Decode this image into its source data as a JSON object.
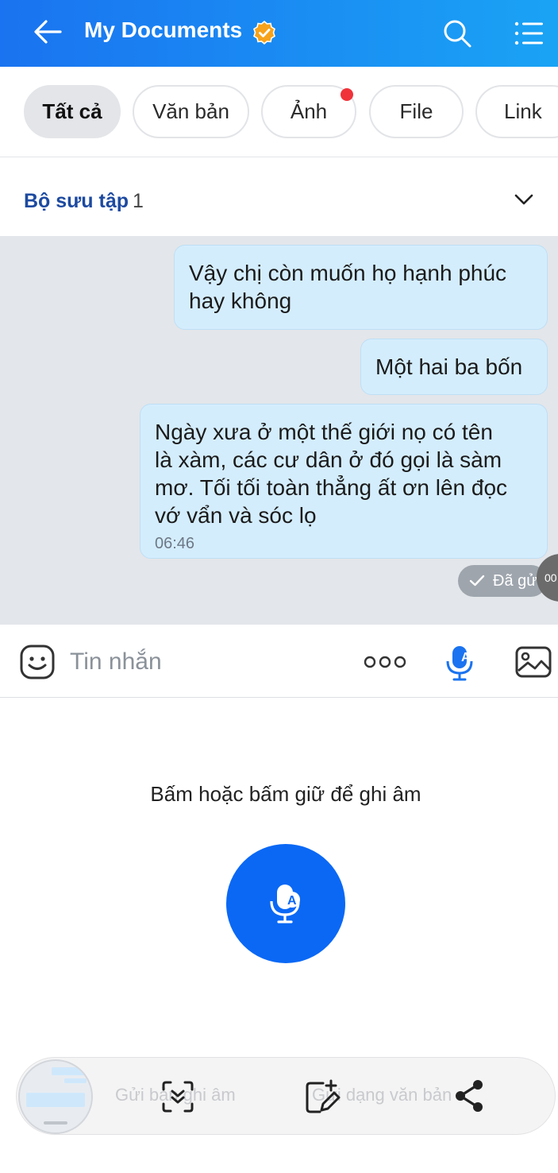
{
  "header": {
    "title": "My Documents",
    "accent_color": "#1a73f0",
    "icons": [
      "back-arrow-icon",
      "verified-badge-icon",
      "search-icon",
      "list-menu-icon"
    ]
  },
  "filters": {
    "items": [
      {
        "label": "Tất cả",
        "active": true
      },
      {
        "label": "Văn bản",
        "active": false
      },
      {
        "label": "Ảnh",
        "active": false,
        "badge": true
      },
      {
        "label": "File",
        "active": false
      },
      {
        "label": "Link",
        "active": false
      }
    ]
  },
  "collection": {
    "label": "Bộ sưu tập",
    "count": "1"
  },
  "messages": [
    {
      "lines": [
        "Vậy chị còn muốn họ hạnh phúc",
        "hay không"
      ]
    },
    {
      "lines": [
        "Một hai ba bốn"
      ]
    },
    {
      "lines": [
        "Ngày xưa ở một thế giới nọ có tên",
        "là xàm, các cư dân ở đó gọi là sàm",
        "mơ. Tối tối toàn thẳng ất ơn lên đọc",
        "vớ vẩn và sóc lọ"
      ],
      "time": "06:46"
    }
  ],
  "sent_status": "Đã gửi",
  "floating_badge": "00",
  "input": {
    "placeholder": "Tin nhắn"
  },
  "record": {
    "hint": "Bấm hoặc bấm giữ để ghi âm"
  },
  "toolbar": {
    "send_audio_label": "Gửi bản ghi âm",
    "send_text_label": "Gửi dạng văn bản"
  }
}
